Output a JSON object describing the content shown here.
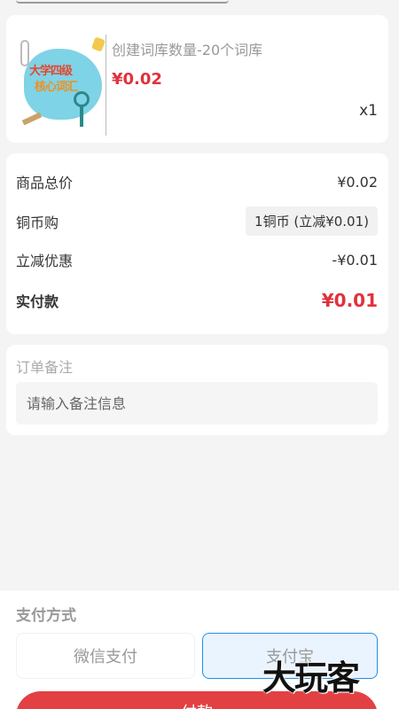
{
  "product": {
    "title": "创建词库数量-20个词库",
    "price": "¥0.02",
    "quantity": "x1",
    "thumbnail": {
      "line1": "大学四级",
      "line2": "核心词汇"
    }
  },
  "summary": {
    "total_label": "商品总价",
    "total_value": "¥0.02",
    "coin_label": "铜币购",
    "coin_value": "1铜币 (立减¥0.01)",
    "discount_label": "立减优惠",
    "discount_value": "-¥0.01",
    "paid_label": "实付款",
    "paid_value": "¥0.01"
  },
  "remark": {
    "title": "订单备注",
    "placeholder": "请输入备注信息"
  },
  "payment": {
    "title": "支付方式",
    "options": [
      "微信支付",
      "支付宝"
    ],
    "selected": "支付宝",
    "button_label": "付款"
  },
  "watermark": "大玩客",
  "colors": {
    "accent": "#e0323e",
    "selected_border": "#1e90e6",
    "selected_bg": "#eaf4ff"
  }
}
